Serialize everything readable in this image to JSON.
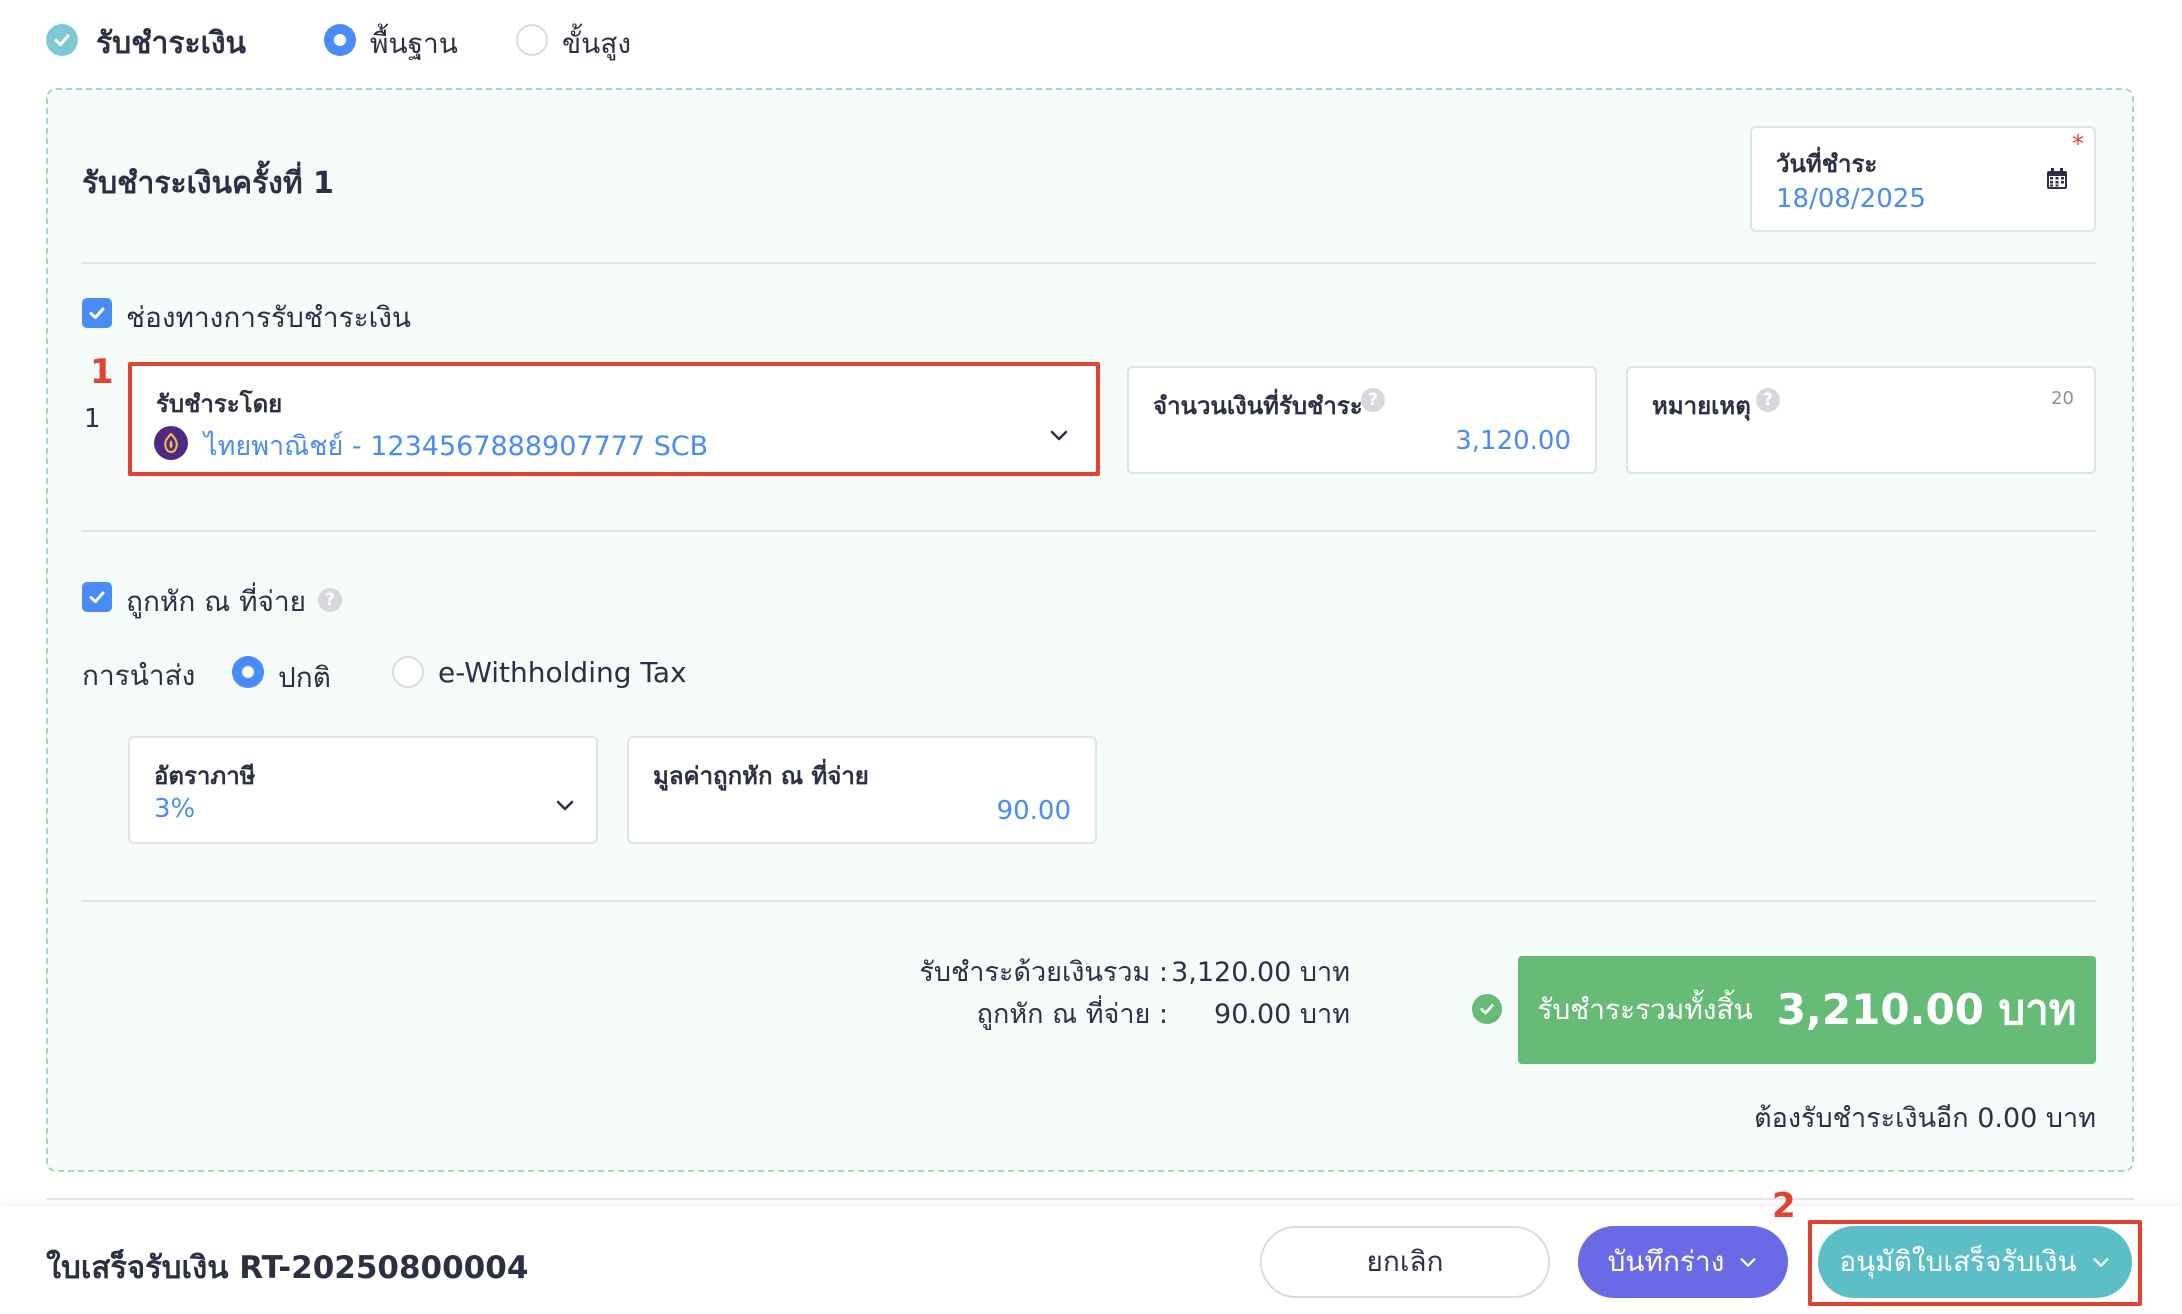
{
  "mode": {
    "title": "รับชำระเงิน",
    "options": [
      "พื้นฐาน",
      "ขั้นสูง"
    ],
    "selected": "พื้นฐาน"
  },
  "payment": {
    "heading": "รับชำระเงินครั้งที่ 1",
    "date_label": "วันที่ชำระ",
    "date_value": "18/08/2025",
    "required_mark": "*",
    "channel_label": "ช่องทางการรับชำระเงิน",
    "row_number": "1",
    "received_by_label": "รับชำระโดย",
    "received_by_value": "ไทยพาณิชย์ - 1234567888907777 SCB",
    "amount_label": "จำนวนเงินที่รับชำระ",
    "amount_value": "3,120.00",
    "note_label": "หมายเหตุ",
    "note_counter": "20"
  },
  "withholding": {
    "label": "ถูกหัก ณ ที่จ่าย",
    "submit_label": "การนำส่ง",
    "submit_options": [
      "ปกติ",
      "e-Withholding Tax"
    ],
    "submit_selected": "ปกติ",
    "rate_label": "อัตราภาษี",
    "rate_value": "3%",
    "wht_value_label": "มูลค่าถูกหัก ณ ที่จ่าย",
    "wht_value": "90.00"
  },
  "summary": {
    "paid_cash_label": "รับชำระด้วยเงินรวม :",
    "paid_cash_value": "3,120.00 บาท",
    "wht_label": "ถูกหัก ณ ที่จ่าย :",
    "wht_value": "90.00 บาท",
    "total_label": "รับชำระรวมทั้งสิ้น",
    "total_value": "3,210.00 บาท",
    "remaining": "ต้องรับชำระเงินอีก 0.00 บาท"
  },
  "footer": {
    "doc_title": "ใบเสร็จรับเงิน RT-20250800004",
    "cancel": "ยกเลิก",
    "save_draft": "บันทึกร่าง",
    "approve": "อนุมัติใบเสร็จรับเงิน"
  },
  "annotations": [
    "1",
    "2"
  ],
  "colors": {
    "accent": "#4a8cf7",
    "success": "#66bb77",
    "teal": "#5cbfc7",
    "purple": "#6b6ae6",
    "highlight": "#e0432f"
  }
}
